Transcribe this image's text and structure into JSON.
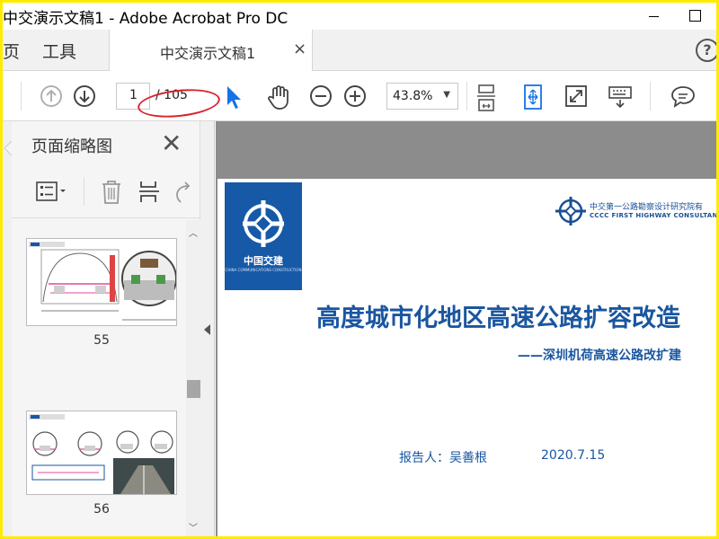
{
  "window": {
    "title": "中交演示文稿1 - Adobe Acrobat Pro DC"
  },
  "menu": {
    "home": "页",
    "tools": "工具"
  },
  "tab": {
    "name": "中交演示文稿1",
    "close": "×"
  },
  "help": {
    "label": "?"
  },
  "toolbar": {
    "current_page": "1",
    "total_pages": "/ 105",
    "zoom": "43.8%"
  },
  "panel": {
    "title": "页面缩略图",
    "thumbnails": [
      {
        "label": "55"
      },
      {
        "label": "56"
      }
    ]
  },
  "page": {
    "logo_text": "中国交建",
    "logo_subtext": "CHINA COMMUNICATIONS CONSTRUCTION",
    "company_cn": "中交第一公路勘察设计研究院有",
    "company_en": "CCCC FIRST HIGHWAY CONSULTANTS C",
    "title": "高度城市化地区高速公路扩容改造",
    "subtitle": "——深圳机荷高速公路改扩建",
    "reporter": "报告人：吴善根",
    "date": "2020.7.15"
  },
  "colors": {
    "accent": "#1a56a0",
    "highlight_ellipse": "#d8262d",
    "window_border": "#ffeb00",
    "pointer_tool": "#1473e6"
  }
}
